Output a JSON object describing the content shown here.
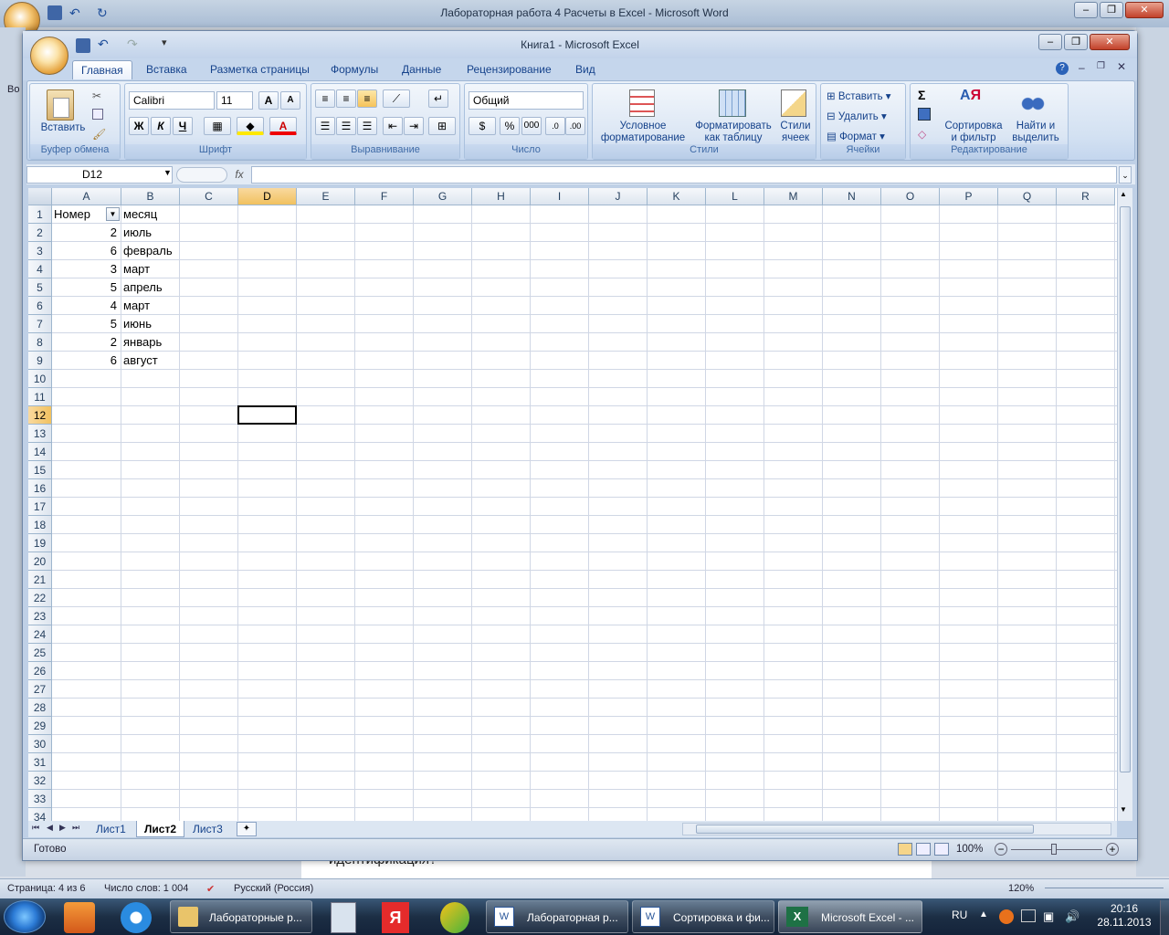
{
  "word": {
    "title": "Лабораторная  работа 4  Расчеты  в  Excel - Microsoft Word",
    "doc_fragment": "идентификация?",
    "left_side_text": "Во",
    "status": {
      "page": "Страница: 4 из 6",
      "words": "Число слов: 1 004",
      "language": "Русский (Россия)",
      "zoom": "120%"
    }
  },
  "excel": {
    "title": "Книга1 - Microsoft Excel",
    "tabs": [
      "Главная",
      "Вставка",
      "Разметка страницы",
      "Формулы",
      "Данные",
      "Рецензирование",
      "Вид"
    ],
    "ribbon": {
      "clipboard": {
        "paste": "Вставить",
        "label": "Буфер обмена"
      },
      "font": {
        "name": "Calibri",
        "size": "11",
        "bold": "Ж",
        "italic": "К",
        "underline": "Ч",
        "label": "Шрифт"
      },
      "alignment": {
        "label": "Выравнивание"
      },
      "number": {
        "format": "Общий",
        "percent": "%",
        "thousands": "000",
        "label": "Число"
      },
      "styles": {
        "conditional_line1": "Условное",
        "conditional_line2": "форматирование",
        "table_line1": "Форматировать",
        "table_line2": "как таблицу",
        "cell_styles_line1": "Стили",
        "cell_styles_line2": "ячеек",
        "label": "Стили"
      },
      "cells": {
        "insert": "Вставить",
        "delete": "Удалить",
        "format": "Формат",
        "label": "Ячейки"
      },
      "editing": {
        "sort_line1": "Сортировка",
        "sort_line2": "и фильтр",
        "find_line1": "Найти и",
        "find_line2": "выделить",
        "label": "Редактирование"
      }
    },
    "name_box": "D12",
    "fx": "fx",
    "columns": [
      "A",
      "B",
      "C",
      "D",
      "E",
      "F",
      "G",
      "H",
      "I",
      "J",
      "K",
      "L",
      "M",
      "N",
      "O",
      "P",
      "Q",
      "R"
    ],
    "selected_column": "D",
    "selected_row": "12",
    "rows": [
      "1",
      "2",
      "3",
      "4",
      "5",
      "6",
      "7",
      "8",
      "9",
      "10",
      "11",
      "12",
      "13",
      "14",
      "15",
      "16",
      "17",
      "18",
      "19",
      "20",
      "21",
      "22",
      "23",
      "24",
      "25",
      "26",
      "27",
      "28",
      "29",
      "30",
      "31",
      "32",
      "33",
      "34"
    ],
    "cells": {
      "A1": "Номер",
      "B1": "месяц",
      "A2": "2",
      "B2": "июль",
      "A3": "6",
      "B3": "февраль",
      "A4": "3",
      "B4": "март",
      "A5": "5",
      "B5": "апрель",
      "A6": "4",
      "B6": "март",
      "A7": "5",
      "B7": "июнь",
      "A8": "2",
      "B8": "январь",
      "A9": "6",
      "B9": "август"
    },
    "sheets": [
      "Лист1",
      "Лист2",
      "Лист3"
    ],
    "active_sheet": "Лист2",
    "status": "Готово",
    "zoom": "100%"
  },
  "taskbar": {
    "items": [
      "Лабораторные р...",
      "Лабораторная  р...",
      "Сортировка и фи...",
      "Microsoft Excel - ..."
    ],
    "lang": "RU",
    "time": "20:16",
    "date": "28.11.2013"
  }
}
